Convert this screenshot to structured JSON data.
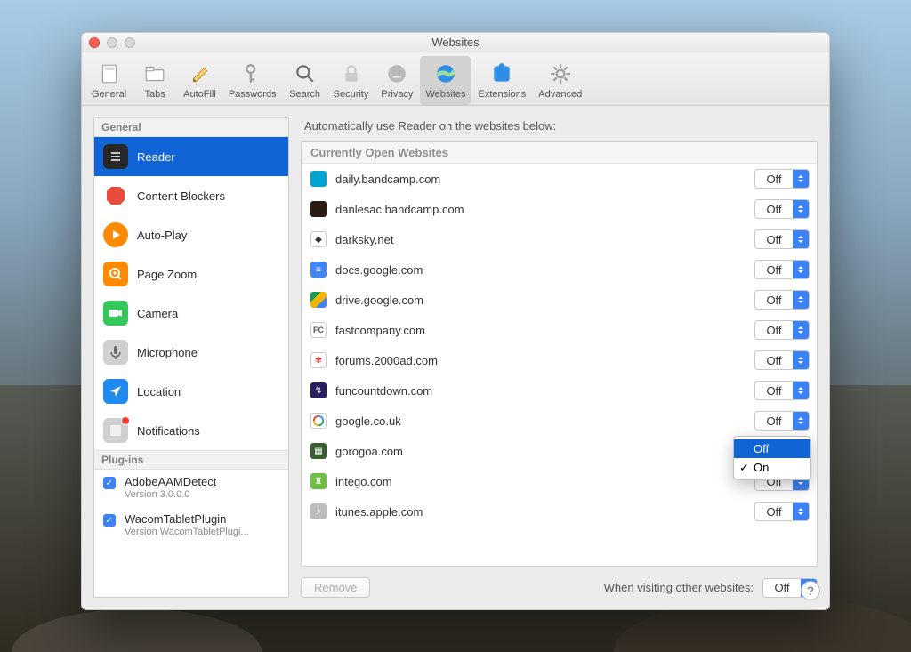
{
  "window": {
    "title": "Websites"
  },
  "toolbar": {
    "items": [
      {
        "label": "General"
      },
      {
        "label": "Tabs"
      },
      {
        "label": "AutoFill"
      },
      {
        "label": "Passwords"
      },
      {
        "label": "Search"
      },
      {
        "label": "Security"
      },
      {
        "label": "Privacy"
      },
      {
        "label": "Websites"
      },
      {
        "label": "Extensions"
      },
      {
        "label": "Advanced"
      }
    ]
  },
  "sidebar": {
    "sections": {
      "general_header": "General",
      "plugins_header": "Plug-ins"
    },
    "items": [
      {
        "label": "Reader"
      },
      {
        "label": "Content Blockers"
      },
      {
        "label": "Auto-Play"
      },
      {
        "label": "Page Zoom"
      },
      {
        "label": "Camera"
      },
      {
        "label": "Microphone"
      },
      {
        "label": "Location"
      },
      {
        "label": "Notifications"
      }
    ],
    "plugins": [
      {
        "name": "AdobeAAMDetect",
        "version": "Version 3.0.0.0"
      },
      {
        "name": "WacomTabletPlugin",
        "version": "Version WacomTabletPlugi..."
      }
    ]
  },
  "main": {
    "title": "Automatically use Reader on the websites below:",
    "list_header": "Currently Open Websites",
    "rows": [
      {
        "domain": "daily.bandcamp.com",
        "value": "Off"
      },
      {
        "domain": "danlesac.bandcamp.com",
        "value": "Off"
      },
      {
        "domain": "darksky.net",
        "value": "Off"
      },
      {
        "domain": "docs.google.com",
        "value": "Off"
      },
      {
        "domain": "drive.google.com",
        "value": "Off"
      },
      {
        "domain": "fastcompany.com",
        "value": "Off"
      },
      {
        "domain": "forums.2000ad.com",
        "value": "Off"
      },
      {
        "domain": "funcountdown.com",
        "value": "Off"
      },
      {
        "domain": "google.co.uk",
        "value": "Off"
      },
      {
        "domain": "gorogoa.com",
        "value": "Off"
      },
      {
        "domain": "intego.com",
        "value": "Off"
      },
      {
        "domain": "itunes.apple.com",
        "value": "Off"
      }
    ],
    "footer": {
      "remove_label": "Remove",
      "other_label": "When visiting other websites:",
      "other_value": "Off"
    }
  },
  "popup": {
    "options": [
      {
        "label": "Off"
      },
      {
        "label": "On"
      }
    ]
  }
}
